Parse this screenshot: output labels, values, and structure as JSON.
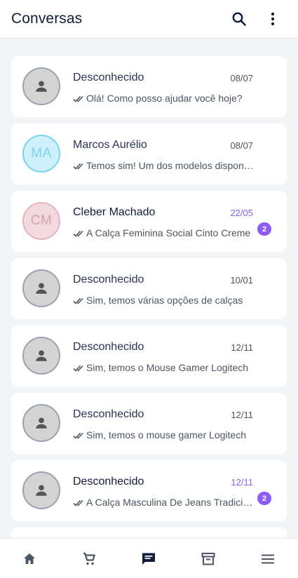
{
  "header": {
    "title": "Conversas",
    "icons": [
      "search-icon",
      "more-vertical-icon"
    ]
  },
  "colors": {
    "accent": "#8b5cf6",
    "text": "#111c3a",
    "background": "#f3f4f6"
  },
  "conversations": [
    {
      "name": "Desconhecido",
      "date": "08/07",
      "preview": "Olá! Como posso ajudar você hoje?",
      "avatar": "person-icon",
      "unread": false
    },
    {
      "name": "Marcos Aurélio",
      "date": "08/07",
      "preview": "Temos sim! Um dos modelos disponíveis",
      "initials": "MA",
      "avatar_bg": "#cdf0fb",
      "avatar_border": "#7dd3f0",
      "avatar_color": "#7dd3f0",
      "unread": false
    },
    {
      "name": "Cleber Machado",
      "date": "22/05",
      "preview": "A Calça Feminina Social Cinto Creme",
      "initials": "CM",
      "avatar_bg": "#f1d9de",
      "avatar_border": "#e6b4bf",
      "avatar_color": "#d8a3ae",
      "unread": true,
      "badge": "2"
    },
    {
      "name": "Desconhecido",
      "date": "10/01",
      "preview": "Sim, temos várias opções de calças",
      "avatar": "person-icon",
      "unread": false
    },
    {
      "name": "Desconhecido",
      "date": "12/11",
      "preview": "Sim, temos o Mouse Gamer Logitech",
      "avatar": "person-icon",
      "unread": false
    },
    {
      "name": "Desconhecido",
      "date": "12/11",
      "preview": "Sim, temos o mouse gamer Logitech",
      "avatar": "person-icon",
      "unread": false
    },
    {
      "name": "Desconhecido",
      "date": "12/11",
      "preview": "A Calça Masculina De Jeans Tradicional",
      "avatar": "person-icon",
      "unread": true,
      "badge": "2"
    }
  ],
  "bottom_nav": [
    {
      "icon": "home-icon",
      "active": false
    },
    {
      "icon": "cart-icon",
      "active": false
    },
    {
      "icon": "chat-icon",
      "active": true
    },
    {
      "icon": "archive-icon",
      "active": false
    },
    {
      "icon": "menu-icon",
      "active": false
    }
  ]
}
